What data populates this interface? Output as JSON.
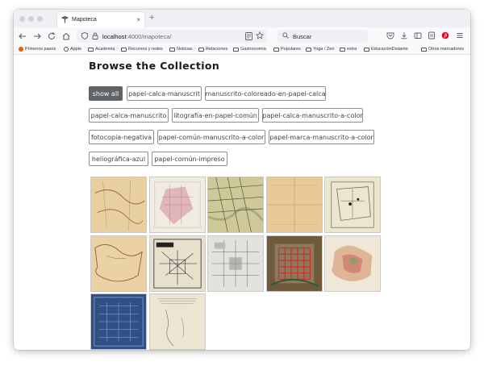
{
  "browser": {
    "tab_title": "Mapoteca",
    "tab_close": "×",
    "new_tab": "+",
    "url_host": "localhost",
    "url_path": ":4000/mapoteca/",
    "search_placeholder": "Buscar"
  },
  "bookmarks": [
    "Primeros pasos",
    "Apple",
    "Academia",
    "Recursos y redes",
    "Noticias",
    "Relaciones",
    "Gastronomía",
    "Populares",
    "Yoga / Zen",
    "extra",
    "EducaciónDistante",
    "Otros marcadores"
  ],
  "page": {
    "heading": "Browse the Collection"
  },
  "filters": [
    "show all",
    "papel-calca-manuscrit",
    "manuscrito-coloreado-en-papel-calca",
    "papel-calca-manuscrito",
    "litografía-en-papel-común",
    "papel-calca-manuscrito-a-color",
    "fotocopia-negativa",
    "papel-común-manuscrito-a-color",
    "papel-marca-manuscrito-a-color",
    "heliográfica-azul",
    "papel-común-impreso"
  ],
  "active_filter": "show all",
  "thumbnails": [
    {
      "kind": "parchment-map",
      "base": "#e8cfa0",
      "ink": "#8a6a40"
    },
    {
      "kind": "pink-street-map",
      "base": "#f1ece2",
      "ink": "#d9a1a6"
    },
    {
      "kind": "green-grid-map",
      "base": "#cfc99a",
      "ink": "#4b5a3a"
    },
    {
      "kind": "faint-tracing",
      "base": "#e9c89a",
      "ink": "#b08a60"
    },
    {
      "kind": "town-plan",
      "base": "#ece6cf",
      "ink": "#555"
    },
    {
      "kind": "coastline-tracing",
      "base": "#ead2a4",
      "ink": "#8c6a44"
    },
    {
      "kind": "engraved-plan",
      "base": "#e7e0cc",
      "ink": "#222"
    },
    {
      "kind": "grey-city-plan",
      "base": "#e4e2dc",
      "ink": "#666"
    },
    {
      "kind": "red-grid-plan",
      "base": "#6f5a3e",
      "ink": "#c0392b"
    },
    {
      "kind": "colored-regions",
      "base": "#efe8d8",
      "ink": "#c86a5a"
    },
    {
      "kind": "blueprint",
      "base": "#2f4f86",
      "ink": "#b9c9e6"
    },
    {
      "kind": "printed-chart",
      "base": "#ece5d2",
      "ink": "#777"
    }
  ]
}
